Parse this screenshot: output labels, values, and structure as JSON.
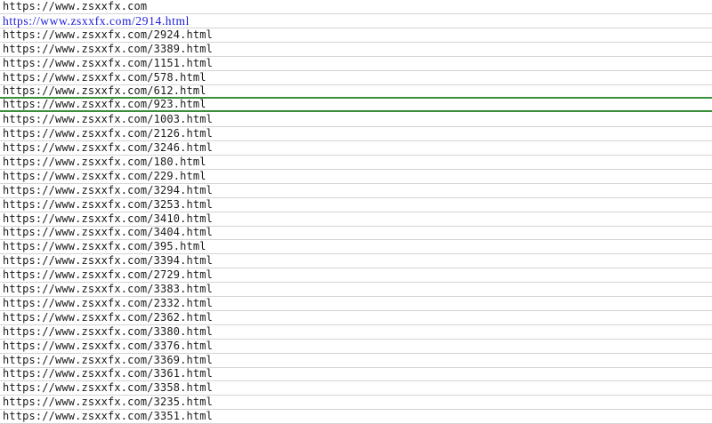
{
  "sheet": {
    "rows": [
      {
        "text": "https://www.zsxxfx.com",
        "style": "plain"
      },
      {
        "text": "https://www.zsxxfx.com/2914.html",
        "style": "link"
      },
      {
        "text": "https://www.zsxxfx.com/2924.html",
        "style": "plain"
      },
      {
        "text": "https://www.zsxxfx.com/3389.html",
        "style": "plain"
      },
      {
        "text": "https://www.zsxxfx.com/1151.html",
        "style": "plain"
      },
      {
        "text": "https://www.zsxxfx.com/578.html",
        "style": "plain"
      },
      {
        "text": "https://www.zsxxfx.com/612.html",
        "style": "plain"
      },
      {
        "text": "https://www.zsxxfx.com/923.html",
        "style": "selected"
      },
      {
        "text": "https://www.zsxxfx.com/1003.html",
        "style": "plain"
      },
      {
        "text": "https://www.zsxxfx.com/2126.html",
        "style": "plain"
      },
      {
        "text": "https://www.zsxxfx.com/3246.html",
        "style": "plain"
      },
      {
        "text": "https://www.zsxxfx.com/180.html",
        "style": "plain"
      },
      {
        "text": "https://www.zsxxfx.com/229.html",
        "style": "plain"
      },
      {
        "text": "https://www.zsxxfx.com/3294.html",
        "style": "plain"
      },
      {
        "text": "https://www.zsxxfx.com/3253.html",
        "style": "plain"
      },
      {
        "text": "https://www.zsxxfx.com/3410.html",
        "style": "plain"
      },
      {
        "text": "https://www.zsxxfx.com/3404.html",
        "style": "plain"
      },
      {
        "text": "https://www.zsxxfx.com/395.html",
        "style": "plain"
      },
      {
        "text": "https://www.zsxxfx.com/3394.html",
        "style": "plain"
      },
      {
        "text": "https://www.zsxxfx.com/2729.html",
        "style": "plain"
      },
      {
        "text": "https://www.zsxxfx.com/3383.html",
        "style": "plain"
      },
      {
        "text": "https://www.zsxxfx.com/2332.html",
        "style": "plain"
      },
      {
        "text": "https://www.zsxxfx.com/2362.html",
        "style": "plain"
      },
      {
        "text": "https://www.zsxxfx.com/3380.html",
        "style": "plain"
      },
      {
        "text": "https://www.zsxxfx.com/3376.html",
        "style": "plain"
      },
      {
        "text": "https://www.zsxxfx.com/3369.html",
        "style": "plain"
      },
      {
        "text": "https://www.zsxxfx.com/3361.html",
        "style": "plain"
      },
      {
        "text": "https://www.zsxxfx.com/3358.html",
        "style": "plain"
      },
      {
        "text": "https://www.zsxxfx.com/3235.html",
        "style": "plain"
      },
      {
        "text": "https://www.zsxxfx.com/3351.html",
        "style": "plain"
      }
    ],
    "colors": {
      "text": "#1a1a1a",
      "link": "#1a1adb",
      "gridline": "#d4d4d4",
      "selection_border": "#3a8f3a"
    }
  }
}
